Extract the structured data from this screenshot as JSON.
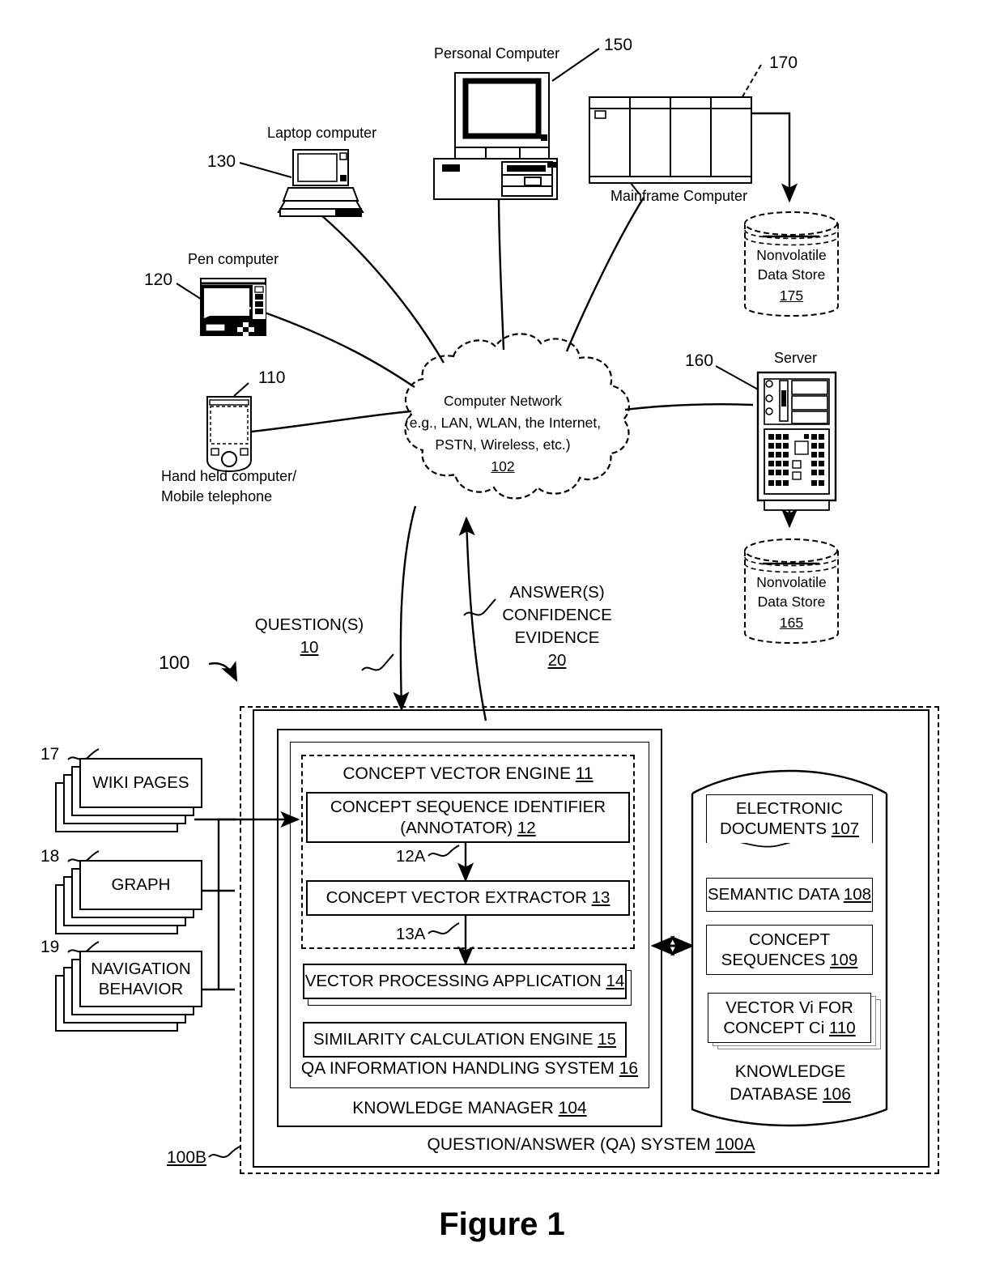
{
  "figure": {
    "title": "Figure 1",
    "system_ref": "100",
    "outer_ref": "100B"
  },
  "network": {
    "name": "Computer Network",
    "detail_line1": "(e.g., LAN, WLAN, the Internet,",
    "detail_line2": "PSTN, Wireless, etc.)",
    "ref": "102"
  },
  "devices": [
    {
      "id": "handheld",
      "label_line1": "Hand held computer/",
      "label_line2": "Mobile telephone",
      "ref": "110"
    },
    {
      "id": "pen",
      "label_line1": "Pen computer",
      "label_line2": "",
      "ref": "120"
    },
    {
      "id": "laptop",
      "label_line1": "Laptop computer",
      "label_line2": "",
      "ref": "130"
    },
    {
      "id": "pc",
      "label_line1": "Personal Computer",
      "label_line2": "",
      "ref": "150"
    },
    {
      "id": "mainframe",
      "label_line1": "Mainframe Computer",
      "label_line2": "",
      "ref": "170"
    },
    {
      "id": "server",
      "label_line1": "Server",
      "label_line2": "",
      "ref": "160"
    }
  ],
  "data_stores": [
    {
      "id": "store-175",
      "line1": "Nonvolatile",
      "line2": "Data Store",
      "ref": "175"
    },
    {
      "id": "store-165",
      "line1": "Nonvolatile",
      "line2": "Data Store",
      "ref": "165"
    }
  ],
  "flows": {
    "question_line1": "QUESTION(S)",
    "question_ref": "10",
    "answer_line1": "ANSWER(S)",
    "answer_line2": "CONFIDENCE",
    "answer_line3": "EVIDENCE",
    "answer_ref": "20"
  },
  "sources": [
    {
      "ref": "17",
      "label_line1": "WIKI PAGES",
      "label_line2": ""
    },
    {
      "ref": "18",
      "label_line1": "GRAPH",
      "label_line2": ""
    },
    {
      "ref": "19",
      "label_line1": "NAVIGATION",
      "label_line2": "BEHAVIOR"
    }
  ],
  "qa_system": {
    "label": "QUESTION/ANSWER (QA) SYSTEM",
    "ref": "100A",
    "knowledge_manager": {
      "label": "KNOWLEDGE MANAGER",
      "ref": "104"
    },
    "qa_ihs": {
      "label": "QA INFORMATION HANDLING SYSTEM",
      "ref": "16"
    },
    "concept_vector_engine": {
      "label": "CONCEPT VECTOR ENGINE",
      "ref": "11",
      "blocks": [
        {
          "line1": "CONCEPT SEQUENCE IDENTIFIER",
          "line2": "(ANNOTATOR)",
          "ref": "12"
        },
        {
          "line1": "CONCEPT VECTOR EXTRACTOR",
          "line2": "",
          "ref": "13"
        }
      ],
      "connectors": [
        "12A",
        "13A"
      ]
    },
    "engine_blocks": [
      {
        "label": "VECTOR PROCESSING APPLICATION",
        "ref": "14"
      },
      {
        "label": "SIMILARITY CALCULATION ENGINE",
        "ref": "15"
      }
    ]
  },
  "knowledge_database": {
    "label_line1": "KNOWLEDGE",
    "label_line2": "DATABASE",
    "ref": "106",
    "items": [
      {
        "line1": "ELECTRONIC",
        "line2": "DOCUMENTS",
        "ref": "107",
        "shape": "doc"
      },
      {
        "line1": "SEMANTIC DATA",
        "line2": "",
        "ref": "108",
        "shape": "rect"
      },
      {
        "line1": "CONCEPT",
        "line2": "SEQUENCES",
        "ref": "109",
        "shape": "rect"
      },
      {
        "line1": "VECTOR Vi FOR",
        "line2": "CONCEPT Ci",
        "ref": "110",
        "shape": "stack"
      }
    ]
  }
}
